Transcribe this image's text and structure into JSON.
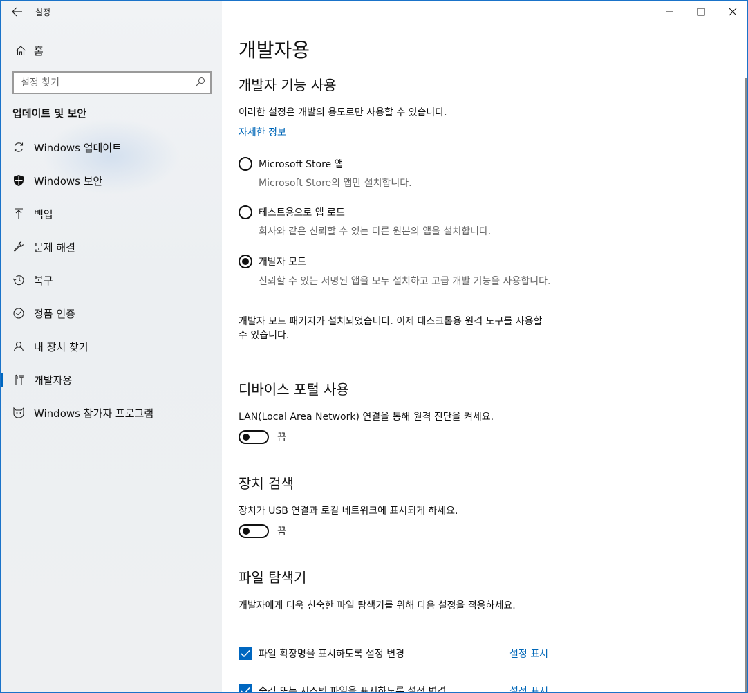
{
  "app": {
    "title": "설정"
  },
  "window_controls": {
    "minimize": "—",
    "maximize": "☐",
    "close": "✕"
  },
  "sidebar": {
    "home_label": "홈",
    "search_placeholder": "설정 찾기",
    "section_title": "업데이트 및 보안",
    "items": [
      {
        "label": "Windows 업데이트",
        "icon": "sync-icon",
        "active": false
      },
      {
        "label": "Windows 보안",
        "icon": "shield-icon",
        "active": false
      },
      {
        "label": "백업",
        "icon": "backup-arrow-icon",
        "active": false
      },
      {
        "label": "문제 해결",
        "icon": "wrench-icon",
        "active": false
      },
      {
        "label": "복구",
        "icon": "history-icon",
        "active": false
      },
      {
        "label": "정품 인증",
        "icon": "checkmark-circle-icon",
        "active": false
      },
      {
        "label": "내 장치 찾기",
        "icon": "person-location-icon",
        "active": false
      },
      {
        "label": "개발자용",
        "icon": "developer-tools-icon",
        "active": true
      },
      {
        "label": "Windows 참가자 프로그램",
        "icon": "insider-cat-icon",
        "active": false
      }
    ]
  },
  "main": {
    "page_title": "개발자용",
    "dev_features": {
      "heading": "개발자 기능 사용",
      "description": "이러한 설정은 개발의 용도로만 사용할 수 있습니다.",
      "learn_more": "자세한 정보",
      "options": [
        {
          "label": "Microsoft Store 앱",
          "desc": "Microsoft Store의 앱만 설치합니다.",
          "checked": false
        },
        {
          "label": "테스트용으로 앱 로드",
          "desc": "회사와 같은 신뢰할 수 있는 다른 원본의 앱을 설치합니다.",
          "checked": false
        },
        {
          "label": "개발자 모드",
          "desc": "신뢰할 수 있는 서명된 앱을 모두 설치하고 고급 개발 기능을 사용합니다.",
          "checked": true
        }
      ],
      "package_note": "개발자 모드 패키지가 설치되었습니다. 이제 데스크톱용 원격 도구를 사용할 수 있습니다."
    },
    "device_portal": {
      "heading": "디바이스 포털 사용",
      "description": "LAN(Local Area Network) 연결을 통해 원격 진단을 켜세요.",
      "toggle_state": "끔"
    },
    "device_discovery": {
      "heading": "장치 검색",
      "description": "장치가 USB 연결과 로컬 네트워크에 표시되게 하세요.",
      "toggle_state": "끔"
    },
    "file_explorer": {
      "heading": "파일 탐색기",
      "description": "개발자에게 더욱 친숙한 파일 탐색기를 위해 다음 설정을 적용하세요.",
      "settings": [
        {
          "label": "파일 확장명을 표시하도록 설정 변경",
          "link": "설정 표시",
          "checked": true
        },
        {
          "label": "숨김 또는 시스템 파일을 표시하도록 설정 변경",
          "link": "설정 표시",
          "checked": true
        }
      ]
    }
  },
  "colors": {
    "accent": "#0067c0",
    "link": "#0067b8"
  }
}
